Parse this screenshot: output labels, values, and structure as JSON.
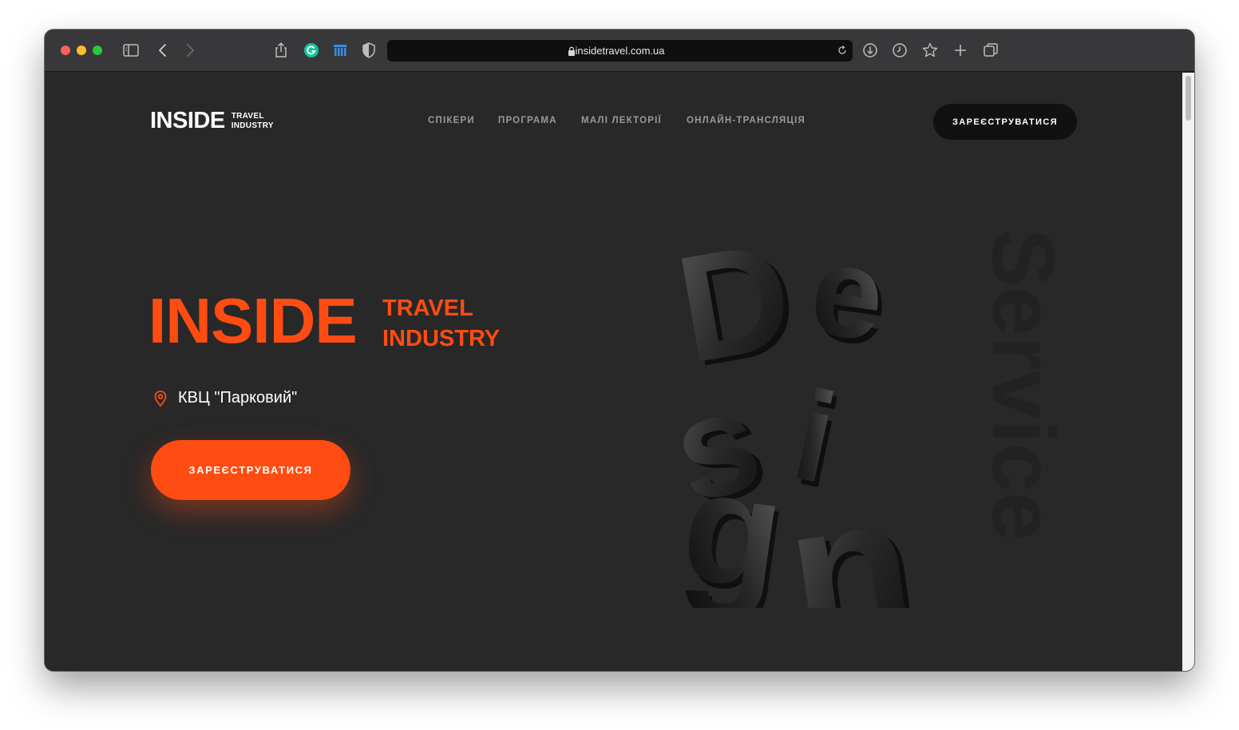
{
  "browser": {
    "url": "insidetravel.com.ua",
    "toolbar_icons": [
      "sidebar-icon",
      "back-arrow-icon",
      "forward-arrow-icon",
      "share-icon",
      "grammarly-icon",
      "library-icon",
      "shield-icon",
      "lock-icon",
      "reload-icon",
      "download-icon",
      "history-icon",
      "bookmark-star-icon",
      "new-tab-icon",
      "tabs-overview-icon"
    ]
  },
  "site": {
    "logo": {
      "main": "INSIDE",
      "line1": "TRAVEL",
      "line2": "INDUSTRY"
    },
    "nav": [
      {
        "label": "СПІКЕРИ"
      },
      {
        "label": "ПРОГРАМА"
      },
      {
        "label": "МАЛІ ЛЕКТОРІЇ"
      },
      {
        "label": "ОНЛАЙН-ТРАНСЛЯЦІЯ"
      }
    ],
    "header_button": "ЗАРЕЄСТРУВАТИСЯ",
    "hero": {
      "title": "INSIDE",
      "subtitle_line1": "TRAVEL",
      "subtitle_line2": "INDUSTRY",
      "location": "КВЦ \"Парковий\"",
      "button": "ЗАРЕЄСТРУВАТИСЯ"
    },
    "artwork": {
      "word_main": "Design",
      "word_side": "Service"
    },
    "colors": {
      "accent": "#ff4c12",
      "background": "#282828",
      "dark_button": "#111111"
    }
  }
}
